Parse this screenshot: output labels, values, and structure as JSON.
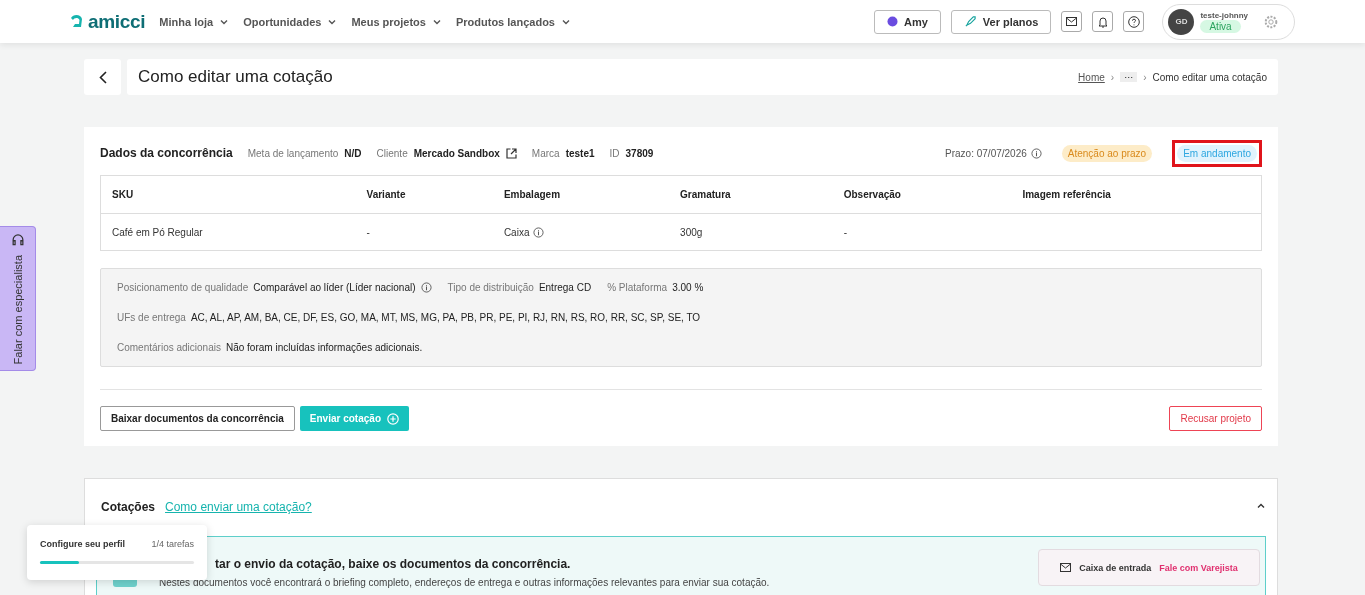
{
  "header": {
    "logo": "amicci",
    "nav": [
      {
        "label": "Minha loja"
      },
      {
        "label": "Oportunidades"
      },
      {
        "label": "Meus projetos"
      },
      {
        "label": "Produtos lançados"
      }
    ],
    "amy_button": "Amy",
    "plans_button": "Ver planos",
    "user": {
      "initials": "GD",
      "name": "teste-johnny",
      "status": "Ativa"
    }
  },
  "page": {
    "title": "Como editar uma cotação",
    "breadcrumb": {
      "home": "Home",
      "separator": "›",
      "ellipsis": "···",
      "separator_2": "›",
      "current": "Como editar uma cotação"
    }
  },
  "competition": {
    "title": "Dados da concorrência",
    "meta": [
      {
        "label": "Meta de lançamento",
        "value": "N/D",
        "kind": "plain"
      },
      {
        "label": "Cliente",
        "value": "Mercado Sandbox",
        "kind": "link"
      },
      {
        "label": "Marca",
        "value": "teste1",
        "kind": "plain"
      },
      {
        "label": "ID",
        "value": "37809",
        "kind": "plain"
      }
    ],
    "deadline": "Prazo: 07/07/2026",
    "badges": [
      {
        "label": "Atenção ao prazo",
        "color": "#fdecc8",
        "highlighted": false
      },
      {
        "label": "Em andamento",
        "color": "#e1f3fd",
        "highlighted": true
      }
    ],
    "table": {
      "columns": [
        "SKU",
        "Variante",
        "Embalagem",
        "Gramatura",
        "Observação",
        "Imagem referência"
      ],
      "rows": [
        {
          "cells": [
            "Café em Pó Regular",
            "-",
            "Caixa",
            "300g",
            "-",
            ""
          ]
        }
      ]
    },
    "details": [
      [
        {
          "label": "Posicionamento de qualidade",
          "value": "Comparável ao líder (Líder nacional)",
          "info": true
        },
        {
          "label": "Tipo de distribuição",
          "value": "Entrega CD",
          "info": false
        },
        {
          "label": "% Plataforma",
          "value": "3.00 %",
          "info": false
        }
      ],
      [
        {
          "label": "UFs de entrega",
          "value": "AC, AL, AP, AM, BA, CE, DF, ES, GO, MA, MT, MS, MG, PA, PB, PR, PE, PI, RJ, RN, RS, RO, RR, SC, SP, SE, TO",
          "info": false
        }
      ],
      [
        {
          "label": "Comentários adicionais",
          "value": "Não foram incluídas informações adicionais.",
          "info": false
        }
      ]
    ],
    "download_button": "Baixar documentos da concorrência",
    "send_button": "Enviar cotação",
    "refuse_button": "Recusar projeto"
  },
  "quotes": {
    "title": "Cotações",
    "help_link": "Como enviar uma cotação?",
    "expanded": true,
    "banner": {
      "title": "tar o envio da cotação, baixe os documentos da concorrência.",
      "text": "Nestes documentos você encontrará o briefing completo, endereços de entrega e outras informações relevantes para enviar sua cotação."
    }
  },
  "side_tab": "Falar com especialista",
  "profile_popup": {
    "title": "Configure seu perfil",
    "count": "1/4 tarefas",
    "level": 0.25
  },
  "inbox_popup": {
    "label": "Caixa de entrada",
    "link": "Fale com Varejista"
  }
}
